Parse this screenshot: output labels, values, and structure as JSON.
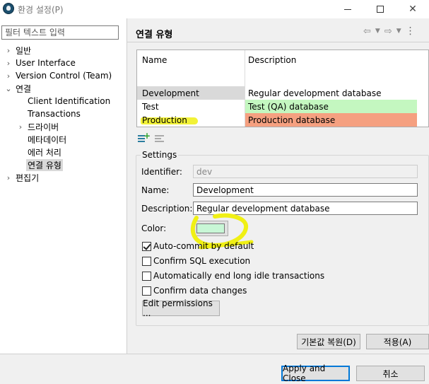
{
  "window": {
    "title": "환경 설정(P)"
  },
  "filter": {
    "placeholder": "필터 텍스트 입력"
  },
  "tree": [
    {
      "label": "일반",
      "chevron": "›"
    },
    {
      "label": "User Interface",
      "chevron": "›"
    },
    {
      "label": "Version Control (Team)",
      "chevron": "›"
    },
    {
      "label": "연결",
      "chevron": "⌄"
    },
    {
      "label": "Client Identification",
      "chevron": ""
    },
    {
      "label": "Transactions",
      "chevron": ""
    },
    {
      "label": "드라이버",
      "chevron": "›"
    },
    {
      "label": "메타데이터",
      "chevron": ""
    },
    {
      "label": "에러 처리",
      "chevron": ""
    },
    {
      "label": "연결 유형",
      "chevron": ""
    },
    {
      "label": "편집기",
      "chevron": "›"
    }
  ],
  "page": {
    "title": "연결 유형"
  },
  "table": {
    "headers": [
      "Name",
      "Description"
    ],
    "rows": [
      {
        "name": "Development",
        "description": "Regular development database",
        "color": "#ffffff"
      },
      {
        "name": "Test",
        "description": "Test (QA) database",
        "color": "#c4f7c0"
      },
      {
        "name": "Production",
        "description": "Production database",
        "color": "#f5a080"
      }
    ]
  },
  "settings": {
    "title": "Settings",
    "identifier_label": "Identifier:",
    "identifier_value": "dev",
    "name_label": "Name:",
    "name_value": "Development",
    "description_label": "Description:",
    "description_value": "Regular development database",
    "color_label": "Color:",
    "color_value": "#c8f7d6",
    "checkboxes": [
      {
        "label": "Auto-commit by default",
        "checked": true
      },
      {
        "label": "Confirm SQL execution",
        "checked": false
      },
      {
        "label": "Automatically end long idle transactions",
        "checked": false
      },
      {
        "label": "Confirm data changes",
        "checked": false
      }
    ],
    "edit_permissions_label": "Edit permissions ..."
  },
  "buttons": {
    "restore_defaults": "기본값 복원(D)",
    "apply": "적용(A)",
    "apply_close": "Apply and Close",
    "cancel": "취소"
  },
  "annotation_color": "#f0f014"
}
